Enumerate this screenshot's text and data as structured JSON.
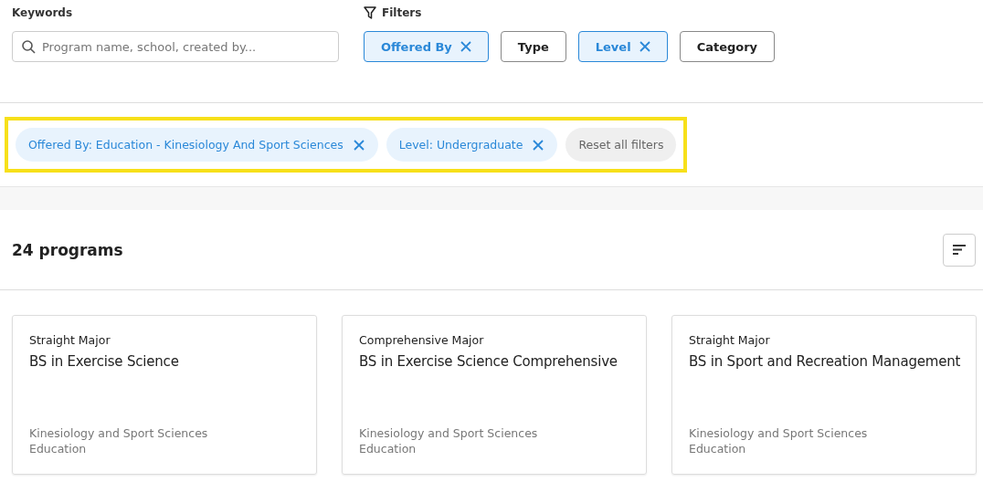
{
  "keywords": {
    "label": "Keywords",
    "placeholder": "Program name, school, created by..."
  },
  "filters": {
    "label": "Filters",
    "buttons": [
      {
        "label": "Offered By",
        "selected": true
      },
      {
        "label": "Type",
        "selected": false
      },
      {
        "label": "Level",
        "selected": true
      },
      {
        "label": "Category",
        "selected": false
      }
    ]
  },
  "active_filters": {
    "highlighted": true,
    "chips": [
      {
        "label": "Offered By: Education - Kinesiology And Sport Sciences"
      },
      {
        "label": "Level: Undergraduate"
      }
    ],
    "reset": "Reset all filters"
  },
  "results": {
    "count": "24 programs"
  },
  "programs": [
    {
      "type": "Straight Major",
      "title": "BS in Exercise Science",
      "department": "Kinesiology and Sport Sciences",
      "school": "Education"
    },
    {
      "type": "Comprehensive Major",
      "title": "BS in Exercise Science Comprehensive",
      "department": "Kinesiology and Sport Sciences",
      "school": "Education"
    },
    {
      "type": "Straight Major",
      "title": "BS in Sport and Recreation Management",
      "department": "Kinesiology and Sport Sciences",
      "school": "Education"
    }
  ]
}
